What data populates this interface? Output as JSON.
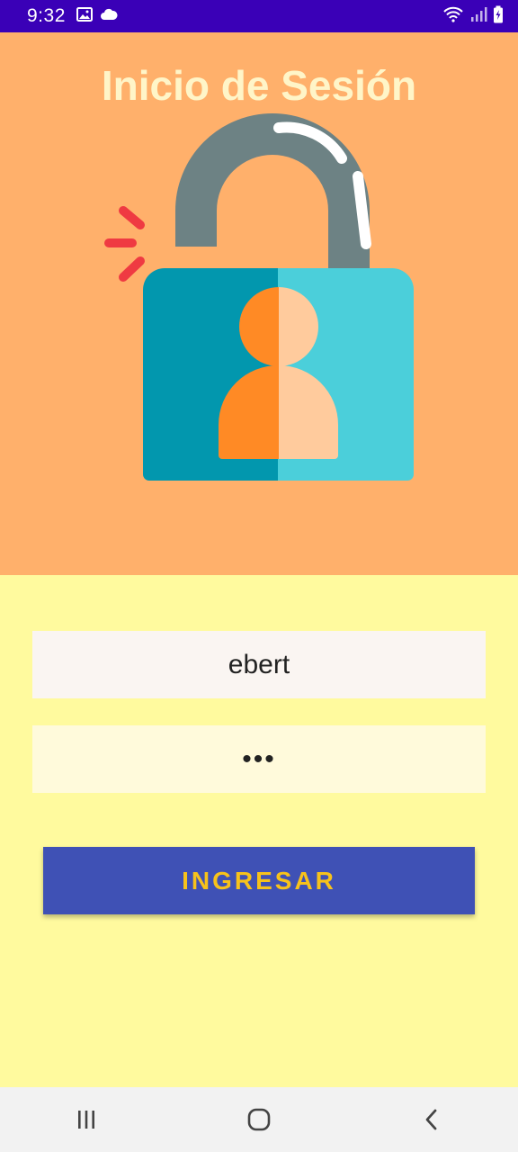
{
  "status_bar": {
    "time": "9:32",
    "icons_left": [
      "image-icon",
      "cloud-icon"
    ],
    "icons_right": [
      "wifi-icon",
      "signal-icon",
      "battery-charging-icon"
    ],
    "background": "#3A00B7"
  },
  "header": {
    "title": "Inicio de Sesión",
    "background": "#FFB06B",
    "illustration": "lock-user-illustration"
  },
  "form": {
    "username_value": "ebert",
    "password_value": "•••",
    "submit_label": "INGRESAR"
  },
  "colors": {
    "form_background": "#FFFA9E",
    "button_background": "#3F51B5",
    "button_text": "#F7C21B",
    "title_text": "#FFF5C8"
  },
  "nav_bar": {
    "buttons": [
      "recent-apps-icon",
      "home-icon",
      "back-icon"
    ]
  }
}
